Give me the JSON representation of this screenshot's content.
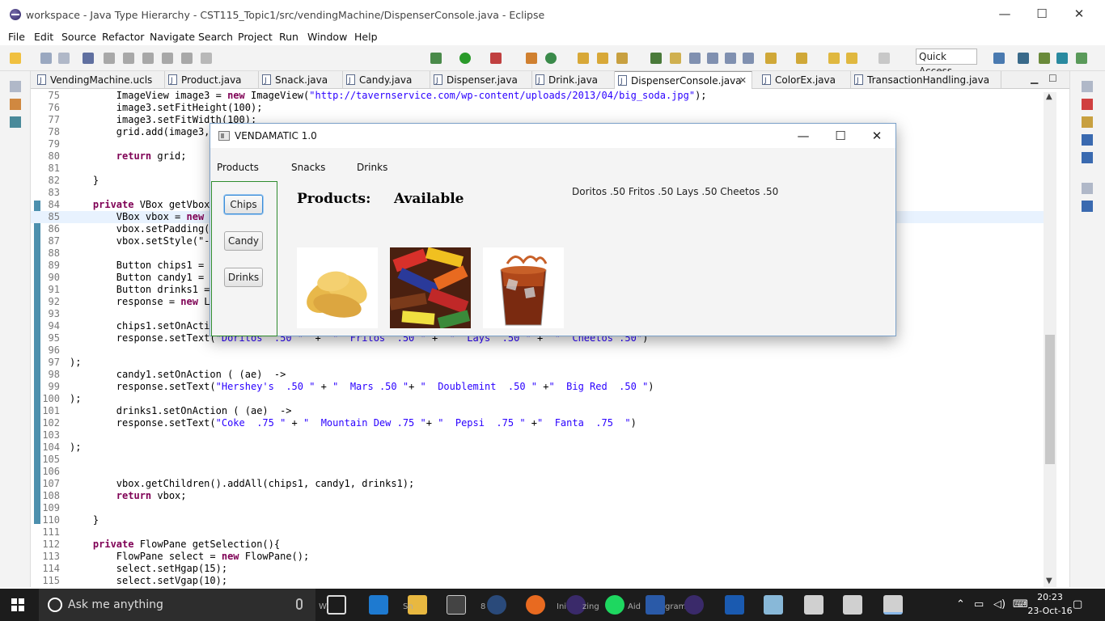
{
  "window": {
    "title": "workspace - Java Type Hierarchy - CST115_Topic1/src/vendingMachine/DispenserConsole.java - Eclipse",
    "minimize": "—",
    "maximize": "☐",
    "close": "✕"
  },
  "menu": [
    "File",
    "Edit",
    "Source",
    "Refactor",
    "Navigate",
    "Search",
    "Project",
    "Run",
    "Window",
    "Help"
  ],
  "toolbar": {
    "quick_access": "Quick Access"
  },
  "tabs": [
    {
      "label": "VendingMachine.ucls"
    },
    {
      "label": "Product.java"
    },
    {
      "label": "Snack.java"
    },
    {
      "label": "Candy.java"
    },
    {
      "label": "Dispenser.java"
    },
    {
      "label": "Drink.java"
    },
    {
      "label": "DispenserConsole.java",
      "active": true,
      "close": "✕"
    },
    {
      "label": "ColorEx.java"
    },
    {
      "label": "TransactionHandling.java"
    }
  ],
  "editor": {
    "current_line": "85",
    "lines": [
      {
        "n": "75",
        "code": "        ImageView image3 = new ImageView(\"http://tavernservice.com/wp-content/uploads/2013/04/big_soda.jpg\");"
      },
      {
        "n": "76",
        "code": "        image3.setFitHeight(100);"
      },
      {
        "n": "77",
        "code": "        image3.setFitWidth(100);"
      },
      {
        "n": "78",
        "code": "        grid.add(image3, "
      },
      {
        "n": "79",
        "code": ""
      },
      {
        "n": "80",
        "code": "        return grid;"
      },
      {
        "n": "81",
        "code": ""
      },
      {
        "n": "82",
        "code": "    }"
      },
      {
        "n": "83",
        "code": ""
      },
      {
        "n": "84",
        "code": "    private VBox getVbox("
      },
      {
        "n": "85",
        "code": "        VBox vbox = new V"
      },
      {
        "n": "86",
        "code": "        vbox.setPadding(n"
      },
      {
        "n": "87",
        "code": "        vbox.setStyle(\"-f"
      },
      {
        "n": "88",
        "code": ""
      },
      {
        "n": "89",
        "code": "        Button chips1 = n"
      },
      {
        "n": "90",
        "code": "        Button candy1 = n"
      },
      {
        "n": "91",
        "code": "        Button drinks1 = "
      },
      {
        "n": "92",
        "code": "        response = new La"
      },
      {
        "n": "93",
        "code": ""
      },
      {
        "n": "94",
        "code": "        chips1.setOnActio"
      },
      {
        "n": "95",
        "code": "        response.setText(\"Doritos  .50 \"  +  \"  Fritos  .50 \" +  \"  Lays  .50 \" +  \"  Cheetos .50\")"
      },
      {
        "n": "96",
        "code": ""
      },
      {
        "n": "97",
        "code": ");"
      },
      {
        "n": "98",
        "code": "        candy1.setOnAction ( (ae)  ->"
      },
      {
        "n": "99",
        "code": "        response.setText(\"Hershey's  .50 \" + \"  Mars .50 \"+ \"  Doublemint  .50 \" +\"  Big Red  .50 \")"
      },
      {
        "n": "100",
        "code": ");"
      },
      {
        "n": "101",
        "code": "        drinks1.setOnAction ( (ae)  ->"
      },
      {
        "n": "102",
        "code": "        response.setText(\"Coke  .75 \" + \"  Mountain Dew .75 \"+ \"  Pepsi  .75 \" +\"  Fanta  .75  \")"
      },
      {
        "n": "103",
        "code": ""
      },
      {
        "n": "104",
        "code": ");"
      },
      {
        "n": "105",
        "code": ""
      },
      {
        "n": "106",
        "code": ""
      },
      {
        "n": "107",
        "code": "        vbox.getChildren().addAll(chips1, candy1, drinks1);"
      },
      {
        "n": "108",
        "code": "        return vbox;"
      },
      {
        "n": "109",
        "code": ""
      },
      {
        "n": "110",
        "code": "    }"
      },
      {
        "n": "111",
        "code": ""
      },
      {
        "n": "112",
        "code": "    private FlowPane getSelection(){"
      },
      {
        "n": "113",
        "code": "        FlowPane select = new FlowPane();"
      },
      {
        "n": "114",
        "code": "        select.setHgap(15);"
      },
      {
        "n": "115",
        "code": "        select.setVgap(10);"
      }
    ]
  },
  "fx_window": {
    "title": "VENDAMATIC 1.0",
    "minimize": "—",
    "maximize": "☐",
    "close": "✕",
    "menu": [
      "Products",
      "Snacks",
      "Drinks"
    ],
    "buttons": [
      "Chips",
      "Candy",
      "Drinks"
    ],
    "heading_products": "Products:",
    "heading_available": "Available",
    "response": "Doritos .50   Fritos .50   Lays .50   Cheetos .50",
    "images": [
      "potato-chips",
      "candy-bars",
      "soda-glass"
    ]
  },
  "taskbar": {
    "search": "Ask me anything",
    "time": "20:23",
    "date": "23-Oct-16",
    "labels": [
      "Wi",
      "Sn",
      "8",
      "Ini",
      "zing",
      "Aid",
      "gram"
    ]
  }
}
